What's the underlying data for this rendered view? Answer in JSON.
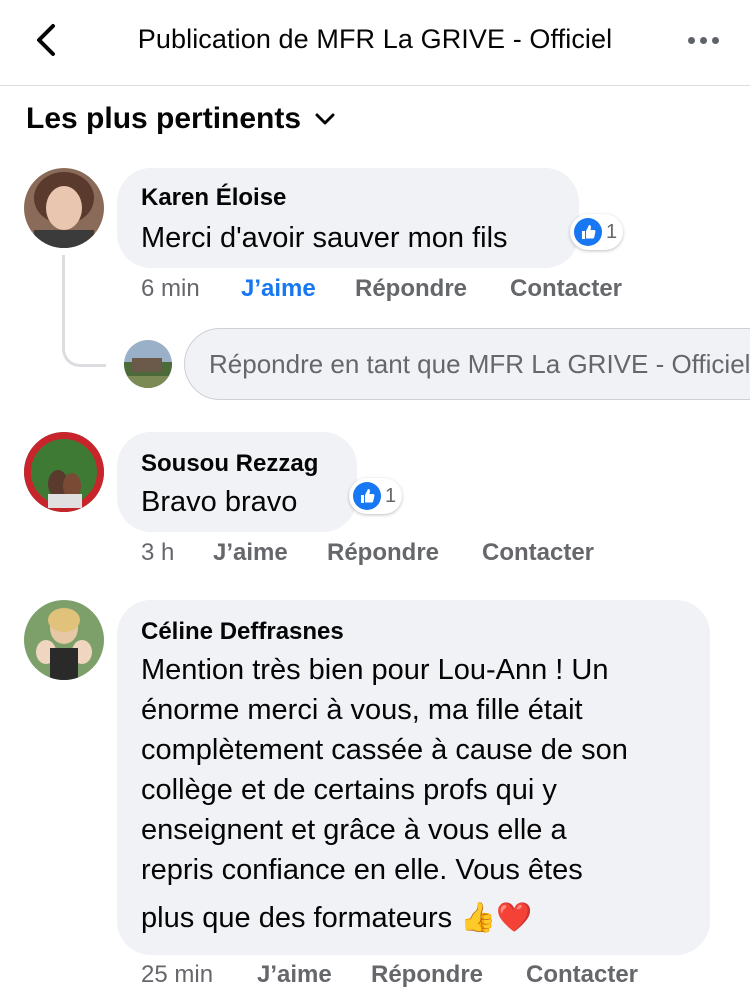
{
  "header": {
    "title": "Publication de MFR La GRIVE - Officiel"
  },
  "sort": {
    "label": "Les plus pertinents"
  },
  "comments": [
    {
      "author": "Karen Éloise",
      "text": "Merci d'avoir sauver mon fils",
      "reaction_count": "1",
      "time": "6 min",
      "like_label": "J’aime",
      "liked": true,
      "reply_label": "Répondre",
      "contact_label": "Contacter"
    },
    {
      "author": "Sousou Rezzag",
      "text": "Bravo bravo",
      "reaction_count": "1",
      "time": "3 h",
      "like_label": "J’aime",
      "liked": false,
      "reply_label": "Répondre",
      "contact_label": "Contacter"
    },
    {
      "author": "Céline Deffrasnes",
      "text_lines": [
        "Mention très bien pour Lou-Ann ! Un",
        "énorme merci à vous, ma fille était",
        "complètement cassée à cause de son",
        "collège et de certains profs qui y",
        "enseignent et grâce à vous elle a",
        "repris confiance en elle. Vous êtes",
        "plus que des formateurs"
      ],
      "emoji": "👍❤️",
      "time": "25 min",
      "like_label": "J’aime",
      "liked": false,
      "reply_label": "Répondre",
      "contact_label": "Contacter"
    }
  ],
  "reply_box": {
    "placeholder": "Répondre en tant que MFR La GRIVE - Officiel"
  },
  "colors": {
    "accent": "#1877f2",
    "bubble": "#f0f2f5",
    "secondary_text": "#65676b"
  }
}
